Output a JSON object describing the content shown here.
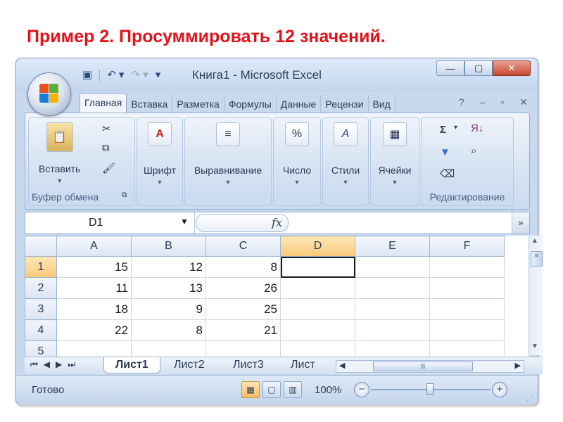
{
  "slide_title": "Пример 2. Просуммировать 12 значений.",
  "window": {
    "title": "Книга1 - Microsoft Excel",
    "controls": {
      "minimize": "—",
      "maximize": "▢",
      "close": "✕"
    }
  },
  "quick_access": {
    "save_icon": "save-icon",
    "undo_icon": "undo-icon",
    "redo_icon": "redo-icon"
  },
  "ribbon": {
    "tabs": [
      "Главная",
      "Вставка",
      "Разметка",
      "Формулы",
      "Данные",
      "Рецензи",
      "Вид"
    ],
    "tab_tools": {
      "help": "?",
      "min": "–",
      "restore": "▫",
      "close": "✕"
    },
    "groups": {
      "clipboard": {
        "paste_label": "Вставить",
        "group_label": "Буфер обмена"
      },
      "font": {
        "label": "Шрифт",
        "icon_text": "A"
      },
      "align": {
        "label": "Выравнивание",
        "icon_text": "≡"
      },
      "number": {
        "label": "Число",
        "icon_text": "%"
      },
      "styles": {
        "label": "Стили",
        "icon_text": "A"
      },
      "cells": {
        "label": "Ячейки",
        "icon_text": "▦"
      },
      "editing": {
        "group_label": "Редактирование",
        "sum_icon": "Σ",
        "sort_icon": "Я↓",
        "find_icon": "⌕"
      }
    }
  },
  "formula_bar": {
    "name_box": "D1",
    "fx": "fx",
    "formula": ""
  },
  "grid": {
    "columns": [
      "A",
      "B",
      "C",
      "D",
      "E",
      "F"
    ],
    "selected_column": "D",
    "rows": [
      {
        "n": "1",
        "cells": [
          "15",
          "12",
          "8",
          "",
          "",
          ""
        ]
      },
      {
        "n": "2",
        "cells": [
          "11",
          "13",
          "26",
          "",
          "",
          ""
        ]
      },
      {
        "n": "3",
        "cells": [
          "18",
          "9",
          "25",
          "",
          "",
          ""
        ]
      },
      {
        "n": "4",
        "cells": [
          "22",
          "8",
          "21",
          "",
          "",
          ""
        ]
      },
      {
        "n": "5",
        "cells": [
          "",
          "",
          "",
          "",
          "",
          ""
        ]
      }
    ],
    "active_cell": "D1"
  },
  "sheets": {
    "tabs": [
      "Лист1",
      "Лист2",
      "Лист3",
      "Лист"
    ],
    "active": "Лист1"
  },
  "status_bar": {
    "ready": "Готово",
    "zoom": "100%"
  }
}
